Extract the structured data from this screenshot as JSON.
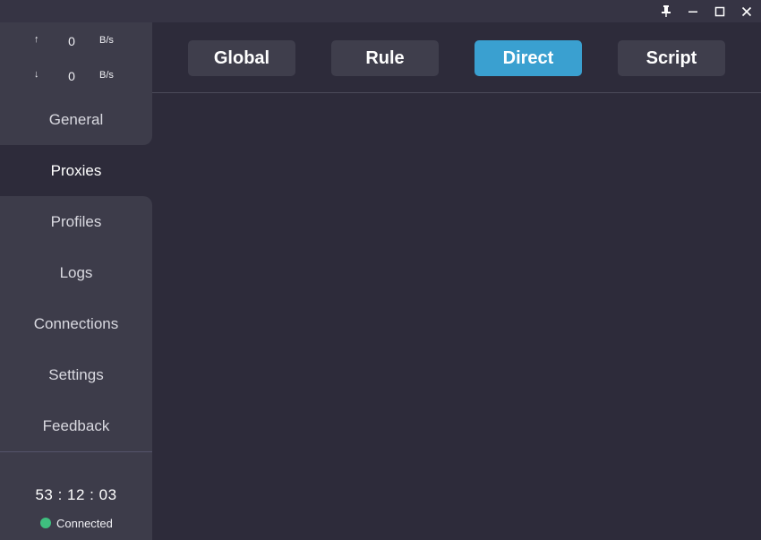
{
  "window": {
    "pin_icon": "pin-icon",
    "minimize_icon": "minimize-icon",
    "maximize_icon": "maximize-icon",
    "close_icon": "close-icon"
  },
  "traffic": {
    "up_arrow": "↑",
    "up_value": "0",
    "up_unit": "B/s",
    "down_arrow": "↓",
    "down_value": "0",
    "down_unit": "B/s"
  },
  "nav": {
    "items": [
      {
        "label": "General"
      },
      {
        "label": "Proxies",
        "active": true
      },
      {
        "label": "Profiles"
      },
      {
        "label": "Logs"
      },
      {
        "label": "Connections"
      },
      {
        "label": "Settings"
      },
      {
        "label": "Feedback"
      }
    ]
  },
  "status": {
    "uptime": "53 : 12 : 03",
    "connection": "Connected",
    "indicator_color": "#3fbf7f"
  },
  "modes": {
    "items": [
      {
        "label": "Global"
      },
      {
        "label": "Rule"
      },
      {
        "label": "Direct",
        "active": true
      },
      {
        "label": "Script"
      }
    ],
    "active_color": "#3aa0d0"
  }
}
